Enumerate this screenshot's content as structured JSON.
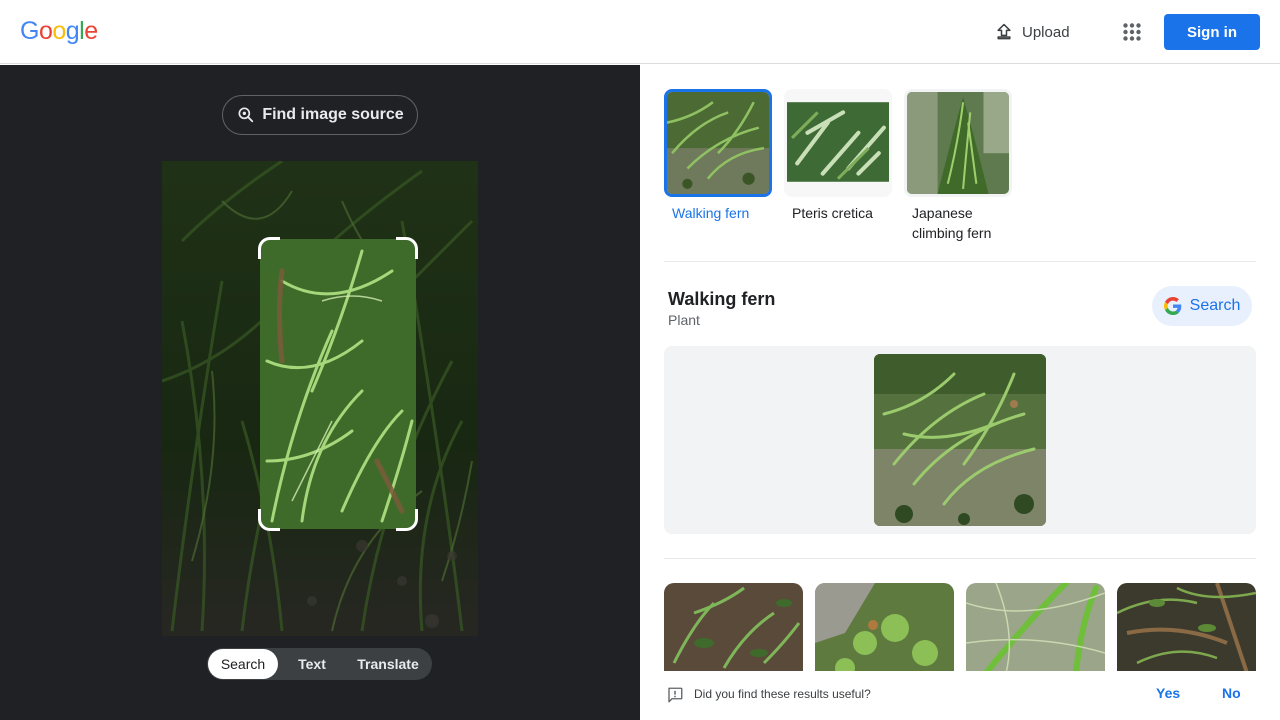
{
  "header": {
    "logo": {
      "letters": [
        "G",
        "o",
        "o",
        "g",
        "l",
        "e"
      ],
      "colors": [
        "#4285f4",
        "#ea4335",
        "#fbbc05",
        "#4285f4",
        "#34a853",
        "#ea4335"
      ]
    },
    "upload_label": "Upload",
    "upload_icon": "upload-icon",
    "apps_icon": "apps-grid-icon",
    "signin_label": "Sign in"
  },
  "left_panel": {
    "find_source_label": "Find image source",
    "find_source_icon": "lens-search-icon",
    "tabs": [
      {
        "label": "Search",
        "active": true
      },
      {
        "label": "Text",
        "active": false
      },
      {
        "label": "Translate",
        "active": false
      }
    ]
  },
  "right_panel": {
    "chips": [
      {
        "label": "Walking fern",
        "selected": true
      },
      {
        "label": "Pteris cretica",
        "selected": false
      },
      {
        "label": "Japanese climbing fern",
        "selected": false
      }
    ],
    "entity": {
      "title": "Walking fern",
      "subtitle": "Plant",
      "search_label": "Search"
    },
    "feedback": {
      "question": "Did you find these results useful?",
      "yes": "Yes",
      "no": "No"
    }
  },
  "colors": {
    "accent": "#1a73e8",
    "dark_panel": "#202124",
    "chip_bg": "#e8f0fe"
  }
}
